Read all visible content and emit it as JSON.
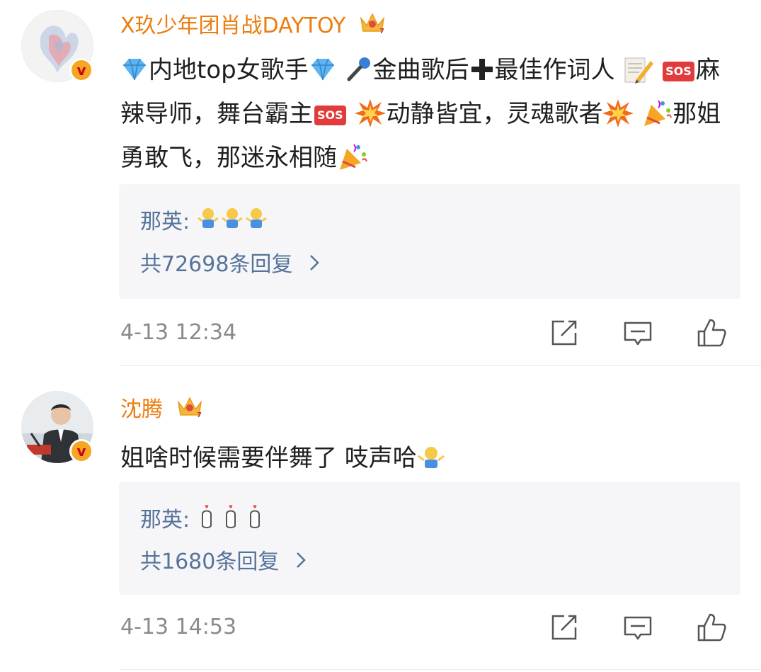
{
  "comments": [
    {
      "username": "X玖少年团肖战DAYTOY",
      "text_parts": [
        "内地top女歌手",
        "金曲歌后",
        "最佳作词人",
        "麻辣导师，舞台霸主",
        "动静皆宜，灵魂歌者",
        "那姐勇敢飞，那迷永相随"
      ],
      "reply": {
        "author": "那英",
        "separator": ":"
      },
      "reply_count_label": "共72698条回复",
      "timestamp": "4-13 12:34"
    },
    {
      "username": "沈腾",
      "text": "姐啥时候需要伴舞了 吱声哈",
      "reply": {
        "author": "那英",
        "separator": ":"
      },
      "reply_count_label": "共1680条回复",
      "timestamp": "4-13 14:53"
    }
  ],
  "icons": {
    "share": "share-icon",
    "comment": "comment-icon",
    "like": "thumbs-up-icon",
    "verified": "verified-badge-icon",
    "crown": "crown-icon",
    "chevron": "chevron-right-icon"
  },
  "colors": {
    "username": "#eb7d0f",
    "reply_link": "#56739a",
    "meta": "#8a8a8a",
    "reply_bg": "#f6f6f8"
  }
}
